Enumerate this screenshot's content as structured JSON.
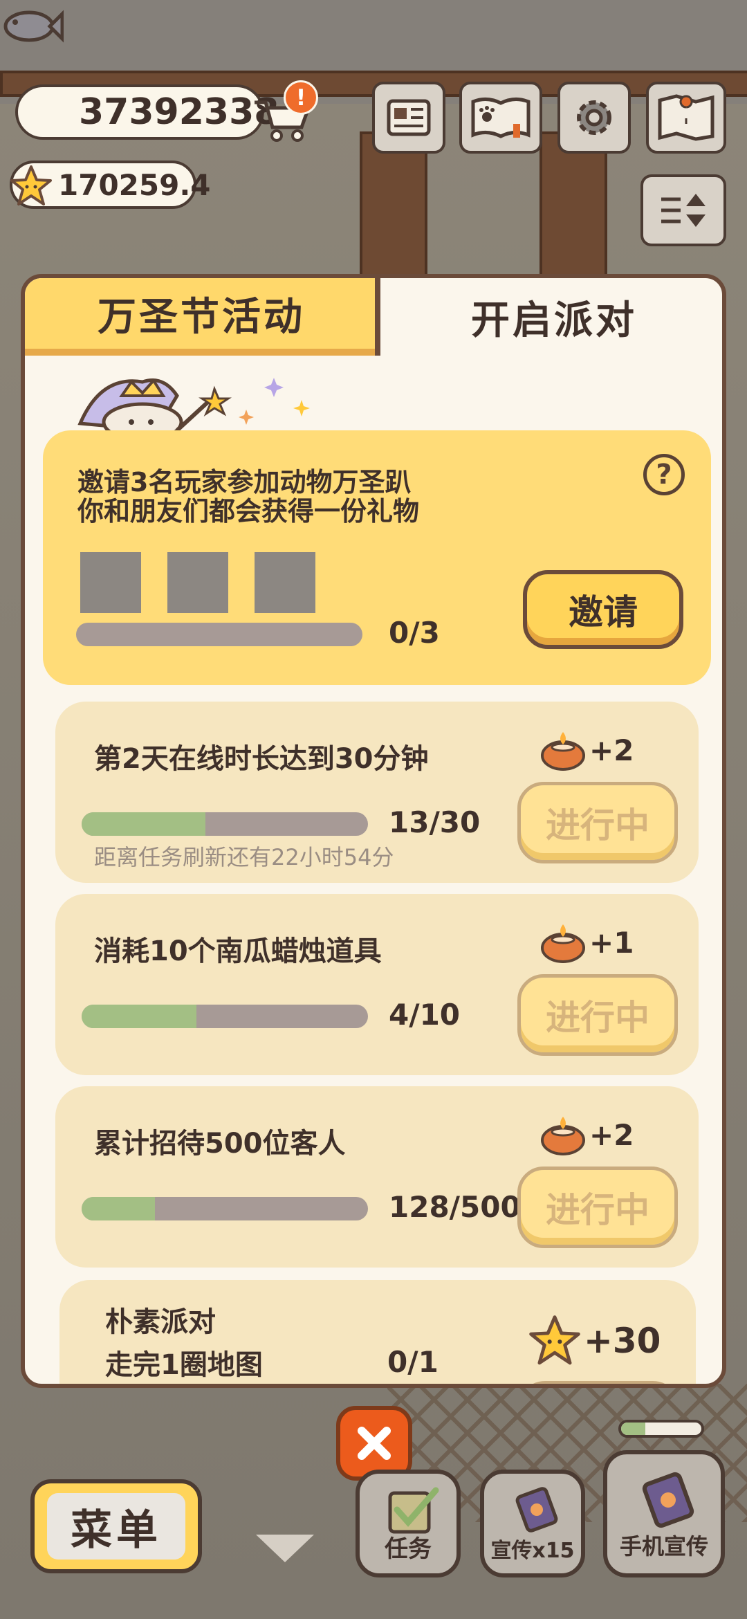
{
  "hud": {
    "fish_count": "37392338",
    "star_count": "170259.4",
    "alert_badge": "!"
  },
  "panel": {
    "tab_active": "万圣节活动",
    "tab_other": "开启派对",
    "invite": {
      "line1": "邀请3名玩家参加动物万圣趴",
      "line2": "你和朋友们都会获得一份礼物",
      "help": "?",
      "progress_text": "0/3",
      "progress_fraction": 0,
      "button": "邀请"
    },
    "tasks": [
      {
        "title": "第2天在线时长达到30分钟",
        "progress_text": "13/30",
        "progress_fraction": 0.433,
        "subtitle": "距离任务刷新还有22小时54分",
        "reward": "+2",
        "button": "进行中"
      },
      {
        "title": "消耗10个南瓜蜡烛道具",
        "progress_text": "4/10",
        "progress_fraction": 0.4,
        "reward": "+1",
        "button": "进行中"
      },
      {
        "title": "累计招待500位客人",
        "progress_text": "128/500",
        "progress_fraction": 0.256,
        "reward": "+2",
        "button": "进行中"
      },
      {
        "title_line1": "朴素派对",
        "title_line2": "走完1圈地图",
        "progress_text": "0/1",
        "reward": "+30"
      }
    ]
  },
  "bottom": {
    "close": "✕",
    "menu": "菜单",
    "task": "任务",
    "promo": "宣传x15",
    "phone_promo": "手机宣传"
  },
  "colors": {
    "panel_border": "#6b4b3a",
    "tab_active_bg": "#ffd86b",
    "progress_fill": "#a3bf84",
    "progress_track": "#a79a96",
    "close_button": "#ec5b1c"
  }
}
